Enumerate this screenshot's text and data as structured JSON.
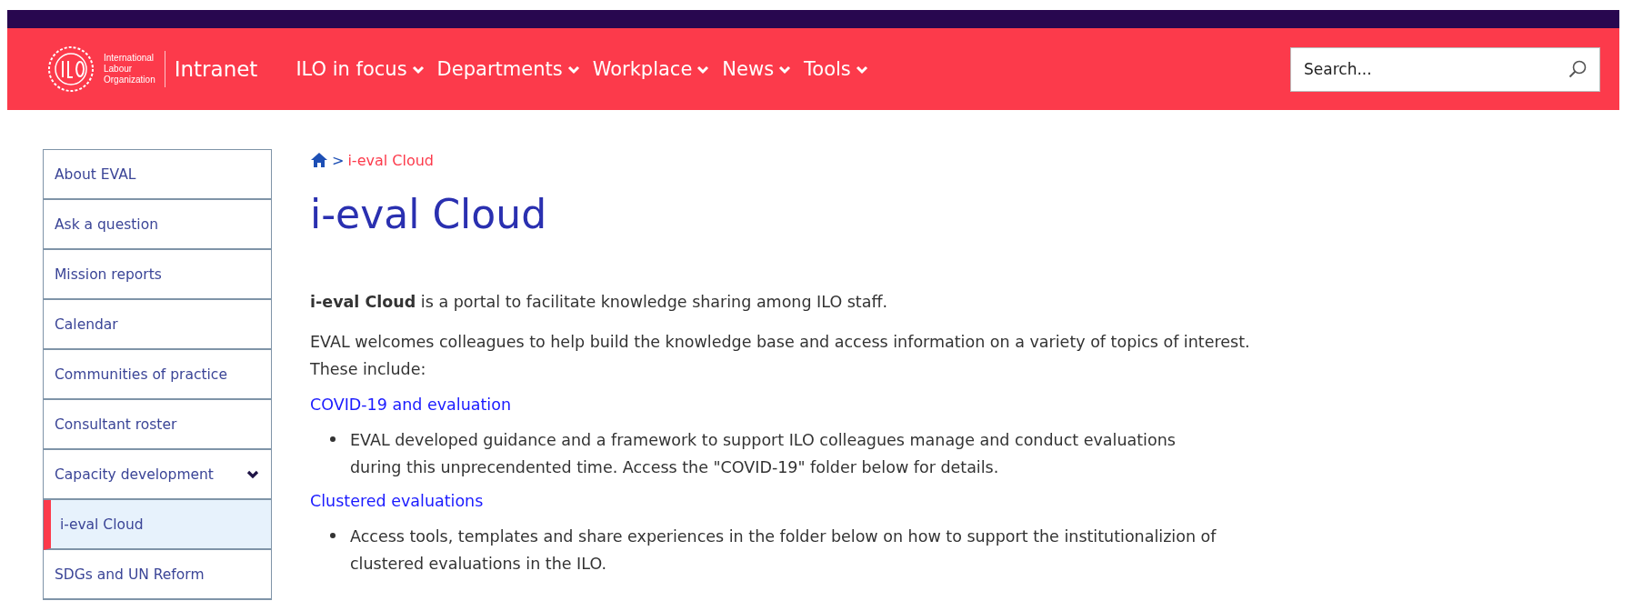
{
  "header": {
    "org_name": [
      "International",
      "Labour",
      "Organization"
    ],
    "site": "Intranet",
    "nav": [
      {
        "label": "ILO in focus",
        "has_menu": true
      },
      {
        "label": "Departments",
        "has_menu": true
      },
      {
        "label": "Workplace",
        "has_menu": true
      },
      {
        "label": "News",
        "has_menu": true
      },
      {
        "label": "Tools",
        "has_menu": true
      }
    ],
    "search": {
      "placeholder": "Search..."
    }
  },
  "sidebar": {
    "items": [
      {
        "label": "About EVAL",
        "selected": false,
        "expanded": false
      },
      {
        "label": "Ask a question",
        "selected": false,
        "expanded": false
      },
      {
        "label": "Mission reports",
        "selected": false,
        "expanded": false
      },
      {
        "label": "Calendar",
        "selected": false,
        "expanded": false
      },
      {
        "label": "Communities of practice",
        "selected": false,
        "expanded": false
      },
      {
        "label": "Consultant roster",
        "selected": false,
        "expanded": false
      },
      {
        "label": "Capacity development",
        "selected": false,
        "expanded": true
      },
      {
        "label": "i-eval Cloud",
        "selected": true,
        "expanded": false
      },
      {
        "label": "SDGs and UN Reform",
        "selected": false,
        "expanded": false
      }
    ]
  },
  "breadcrumb": {
    "separator": ">",
    "current": "i-eval Cloud"
  },
  "title": "i-eval Cloud",
  "content": [
    {
      "kind": "paragraph",
      "text": "**i-eval Cloud** is a portal to facilitate knowledge sharing among ILO staff."
    },
    {
      "kind": "paragraph",
      "text": "EVAL welcomes colleagues to help build the knowledge base and access information on a variety of topics of interest. These include:"
    },
    {
      "kind": "link",
      "text": "COVID-19 and evaluation"
    },
    {
      "kind": "bullet",
      "text": "EVAL developed guidance and a framework to support ILO colleagues manage and conduct evaluations during this unprecendented time. Access the \"COVID-19\" folder below for details."
    },
    {
      "kind": "link",
      "text": "Clustered evaluations"
    },
    {
      "kind": "bullet",
      "text": "Access tools, templates and share experiences in the folder below on how to support the institutionalizion of clustered evaluations in the ILO."
    }
  ]
}
